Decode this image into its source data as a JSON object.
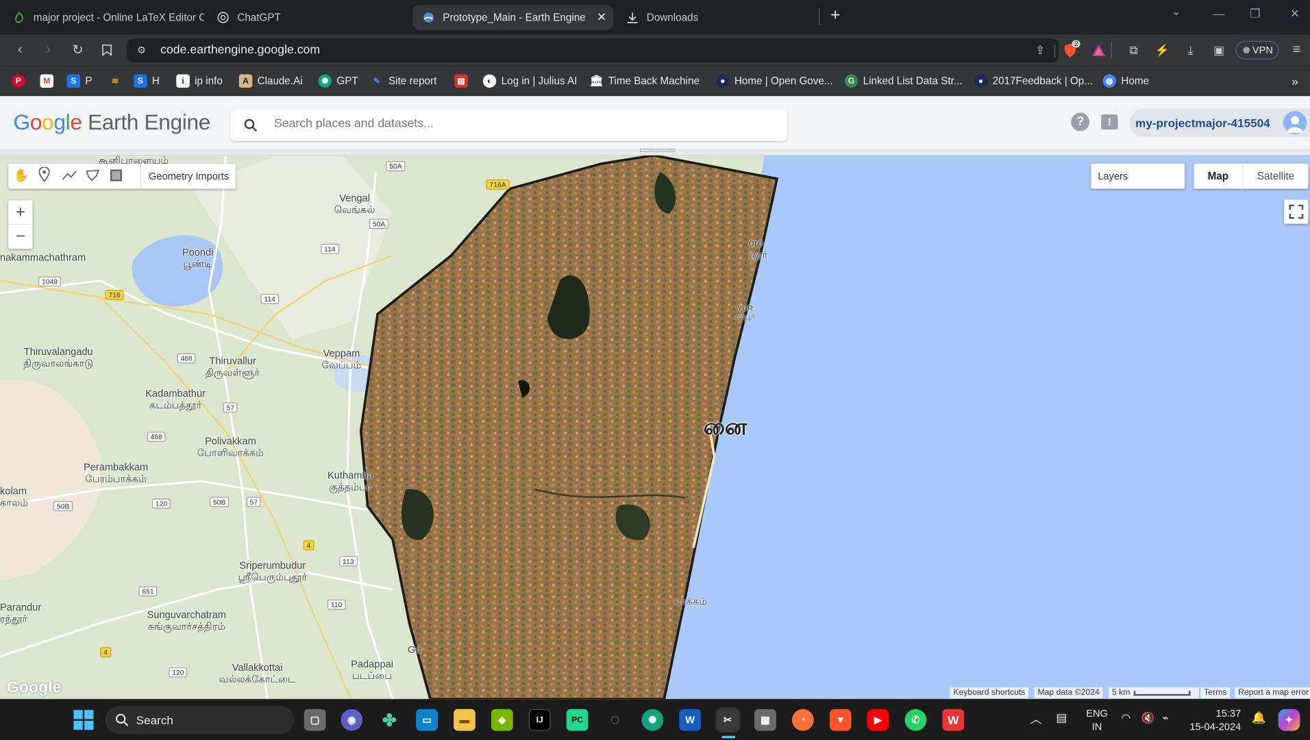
{
  "browser": {
    "tabs": [
      {
        "title": "major project - Online LaTeX Editor O"
      },
      {
        "title": "ChatGPT"
      },
      {
        "title": "Prototype_Main - Earth Engine C"
      },
      {
        "title": "Downloads"
      }
    ],
    "url": "code.earthengine.google.com",
    "brave_badge": "2",
    "vpn_label": "VPN",
    "bookmarks": [
      {
        "label": ""
      },
      {
        "label": ""
      },
      {
        "label": "P"
      },
      {
        "label": ""
      },
      {
        "label": "H"
      },
      {
        "label": "ip info"
      },
      {
        "label": "Claude.Ai"
      },
      {
        "label": "GPT"
      },
      {
        "label": "Site report"
      },
      {
        "label": ""
      },
      {
        "label": "Log in | Julius AI"
      },
      {
        "label": "Time Back Machine"
      },
      {
        "label": "Home | Open Gove..."
      },
      {
        "label": "Linked List Data Str..."
      },
      {
        "label": "2017Feedback | Op..."
      },
      {
        "label": "Home"
      }
    ]
  },
  "gee": {
    "logo_google": "Google",
    "logo_product": "Earth Engine",
    "search_placeholder": "Search places and datasets...",
    "project": "my-projectmajor-415504"
  },
  "map": {
    "geometry_imports": "Geometry Imports",
    "layers_label": "Layers",
    "map_tab": "Map",
    "satellite_tab": "Satellite",
    "zoom_in": "+",
    "zoom_out": "−",
    "google_watermark": "Google",
    "footer": {
      "shortcuts": "Keyboard shortcuts",
      "map_data": "Map data ©2024",
      "scale": "5 km",
      "terms": "Terms",
      "report": "Report a map error"
    },
    "labels": [
      {
        "text": "கூனிபாளையம்"
      },
      {
        "text": "Vengal\nவெங்கல்"
      },
      {
        "text": "Poondi\nபூண்டி"
      },
      {
        "text": "nakammachathram"
      },
      {
        "text": "Thiruvalangadu\nதிருவாலங்காடு"
      },
      {
        "text": "Thiruvallur\nதிருவள்ளூர்"
      },
      {
        "text": "Veppam\nவேப்பம்"
      },
      {
        "text": "Kadambathur\nகடம்பத்தூர்"
      },
      {
        "text": "Polivakkam\nபோளிவாக்கம்"
      },
      {
        "text": "Perambakkam\nபேரம்பாக்கம்"
      },
      {
        "text": "Kuthamba\nகுத்தம்பா"
      },
      {
        "text": "kolam\nகாலம்"
      },
      {
        "text": "Sriperumbudur\nஸ்ரீபெரும்புதூர்"
      },
      {
        "text": "Parandur\nரந்தூர்"
      },
      {
        "text": "Sunguvarchatram\nசுங்குவார்சத்திரம்"
      },
      {
        "text": "Vallakkottai\nவல்லக்கோட்டை"
      },
      {
        "text": "Padappai\nபடப்பை"
      },
      {
        "text": "ore\nனூர்"
      },
      {
        "text": "YUR\nவியூர்"
      },
      {
        "text": "னை"
      },
      {
        "text": "ாக்கம்"
      },
      {
        "text": "Gu"
      }
    ],
    "routes": [
      {
        "text": "50A"
      },
      {
        "text": "716A"
      },
      {
        "text": "50A"
      },
      {
        "text": "114"
      },
      {
        "text": "1049"
      },
      {
        "text": "716"
      },
      {
        "text": "114"
      },
      {
        "text": "468"
      },
      {
        "text": "57"
      },
      {
        "text": "468"
      },
      {
        "text": "50B"
      },
      {
        "text": "120"
      },
      {
        "text": "50B"
      },
      {
        "text": "57"
      },
      {
        "text": "4"
      },
      {
        "text": "113"
      },
      {
        "text": "651"
      },
      {
        "text": "110"
      },
      {
        "text": "4"
      },
      {
        "text": "120"
      }
    ]
  },
  "taskbar": {
    "search": "Search",
    "lang_top": "ENG",
    "lang_bottom": "IN",
    "time": "15:37",
    "date": "15-04-2024"
  }
}
